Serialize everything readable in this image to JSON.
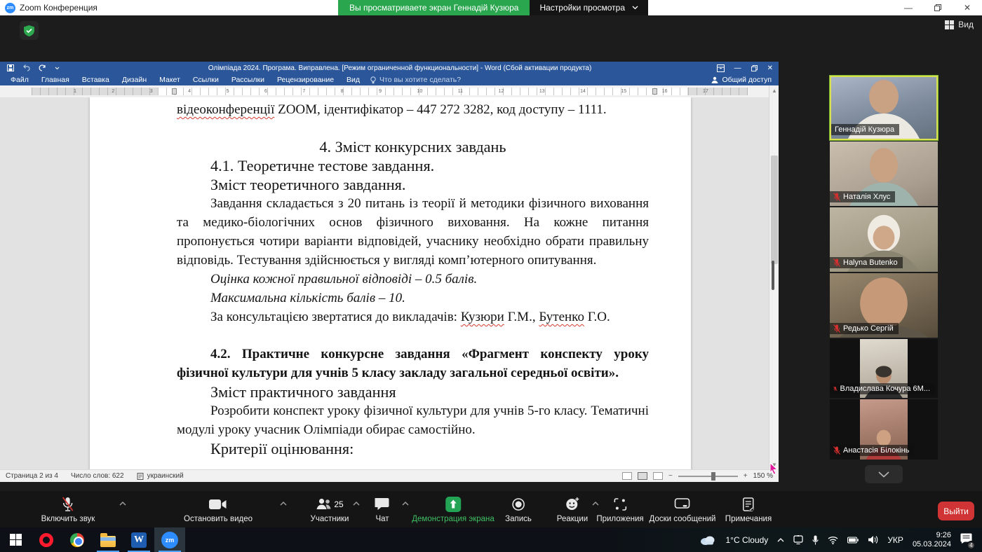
{
  "zoom_titlebar": {
    "app_title": "Zoom Конференция",
    "banner": "Вы просматриваете экран Геннадій Кузюра",
    "view_settings_label": "Настройки просмотра",
    "view_label": "Вид"
  },
  "word": {
    "title": "Олімпіада 2024. Програма. Виправлена. [Режим ограниченной функциональности] - Word (Сбой активации продукта)",
    "tabs": [
      "Файл",
      "Главная",
      "Вставка",
      "Дизайн",
      "Макет",
      "Ссылки",
      "Рассылки",
      "Рецензирование",
      "Вид"
    ],
    "tell_me": "Что вы хотите сделать?",
    "share_label": "Общий доступ",
    "ruler": [
      "1",
      "2",
      "3",
      "4",
      "5",
      "6",
      "7",
      "8",
      "9",
      "10",
      "11",
      "12",
      "13",
      "14",
      "15",
      "16",
      "17"
    ],
    "doc": {
      "l1_misspelled": "відеоконференції",
      "l1_rest": " ZOOM, ідентифікатор – 447 272 3282, код доступу – 1111.",
      "h4": "4. Зміст конкурсних завдань",
      "h41": "4.1. Теоретичне тестове завдання.",
      "h41b": "Зміст теоретичного завдання.",
      "p1": "Завдання складається з 20 питань із теорії й методики фізичного виховання та медико-біологічних основ фізичного виховання. На кожне питання пропонується чотири варіанти відповідей, учаснику необхідно обрати правильну відповідь. Тестування здійснюється у вигляді комп’ютерного опитування.",
      "i1": "Оцінка кожної правильної відповіді – 0.5 балів.",
      "i2": "Максимальна кількість балів – 10.",
      "c_pre": "За консультацією звертатися до викладачів: ",
      "c_w1": "Кузюри",
      "c_m1": " Г.М., ",
      "c_w2": "Бутенко",
      "c_m2": " Г.О.",
      "h42": "4.2. Практичне конкурсне завдання «Фрагмент конспекту уроку фізичної культури для учнів 5 класу закладу загальної середньої освіти».",
      "h42b": "Зміст практичного завдання",
      "p2": "Розробити конспект уроку фізичної культури для учнів 5-го класу. Тематичні модулі уроку учасник Олімпіади обирає самостійно.",
      "hcrit": "Критерії оцінювання:"
    },
    "status": {
      "page": "Страница 2 из 4",
      "words": "Число слов: 622",
      "language": "украинский",
      "zoom_level": "150 %"
    }
  },
  "participants": [
    {
      "name": "Геннадій Кузюра",
      "muted": false,
      "active": true
    },
    {
      "name": "Наталія Хлус",
      "muted": true
    },
    {
      "name": "Halyna Butenko",
      "muted": true
    },
    {
      "name": "Редько Сергій",
      "muted": true
    },
    {
      "name": "Владислава Кочура 6М...",
      "muted": true
    },
    {
      "name": "Анастасія Білокінь",
      "muted": true
    }
  ],
  "toolbar": {
    "mute_label": "Включить звук",
    "video_label": "Остановить видео",
    "participants_label": "Участники",
    "participants_count": "25",
    "chat_label": "Чат",
    "share_label": "Демонстрация экрана",
    "record_label": "Запись",
    "reactions_label": "Реакции",
    "apps_label": "Приложения",
    "boards_label": "Доски сообщений",
    "notes_label": "Примечания",
    "leave_label": "Выйти"
  },
  "taskbar": {
    "weather": "1°C Cloudy",
    "language": "УКР",
    "time": "9:26",
    "date": "05.03.2024",
    "notification_count": "4"
  },
  "colors": {
    "banner_green": "#29a64e",
    "word_blue": "#2b579a",
    "share_green": "#23a455",
    "leave_red": "#d03434",
    "active_speaker_border": "#d9e050"
  }
}
